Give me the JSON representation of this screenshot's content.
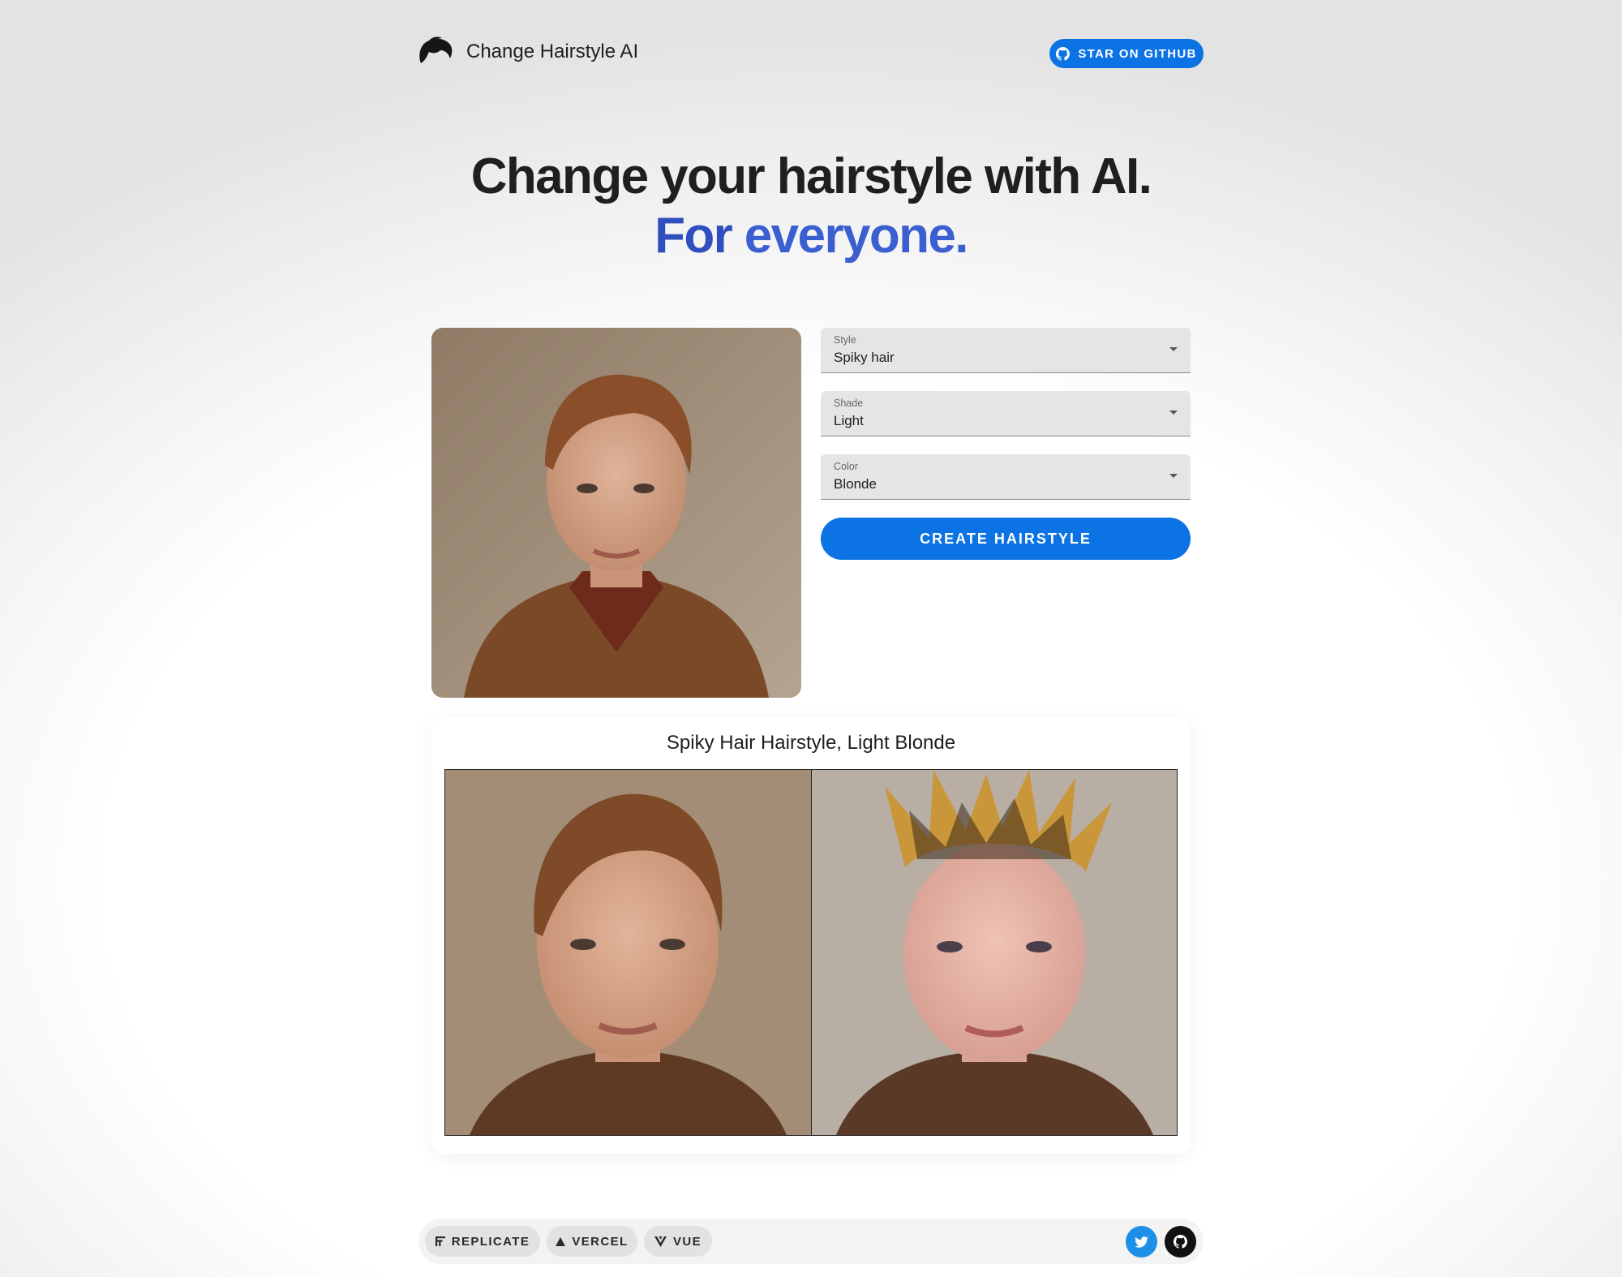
{
  "header": {
    "brand": "Change Hairstyle AI",
    "github_button": "STAR ON GITHUB"
  },
  "hero": {
    "line1": "Change your hairstyle with AI.",
    "line2_a": "For",
    "line2_b": "everyone."
  },
  "form": {
    "style": {
      "label": "Style",
      "value": "Spiky hair"
    },
    "shade": {
      "label": "Shade",
      "value": "Light"
    },
    "color": {
      "label": "Color",
      "value": "Blonde"
    },
    "submit": "CREATE HAIRSTYLE"
  },
  "result": {
    "title": "Spiky Hair Hairstyle, Light Blonde"
  },
  "footer": {
    "chips": [
      "REPLICATE",
      "VERCEL",
      "VUE"
    ]
  },
  "colors": {
    "primary": "#0b73e3",
    "hero_accent": "#2f4fbe",
    "twitter": "#1d8fe6"
  }
}
